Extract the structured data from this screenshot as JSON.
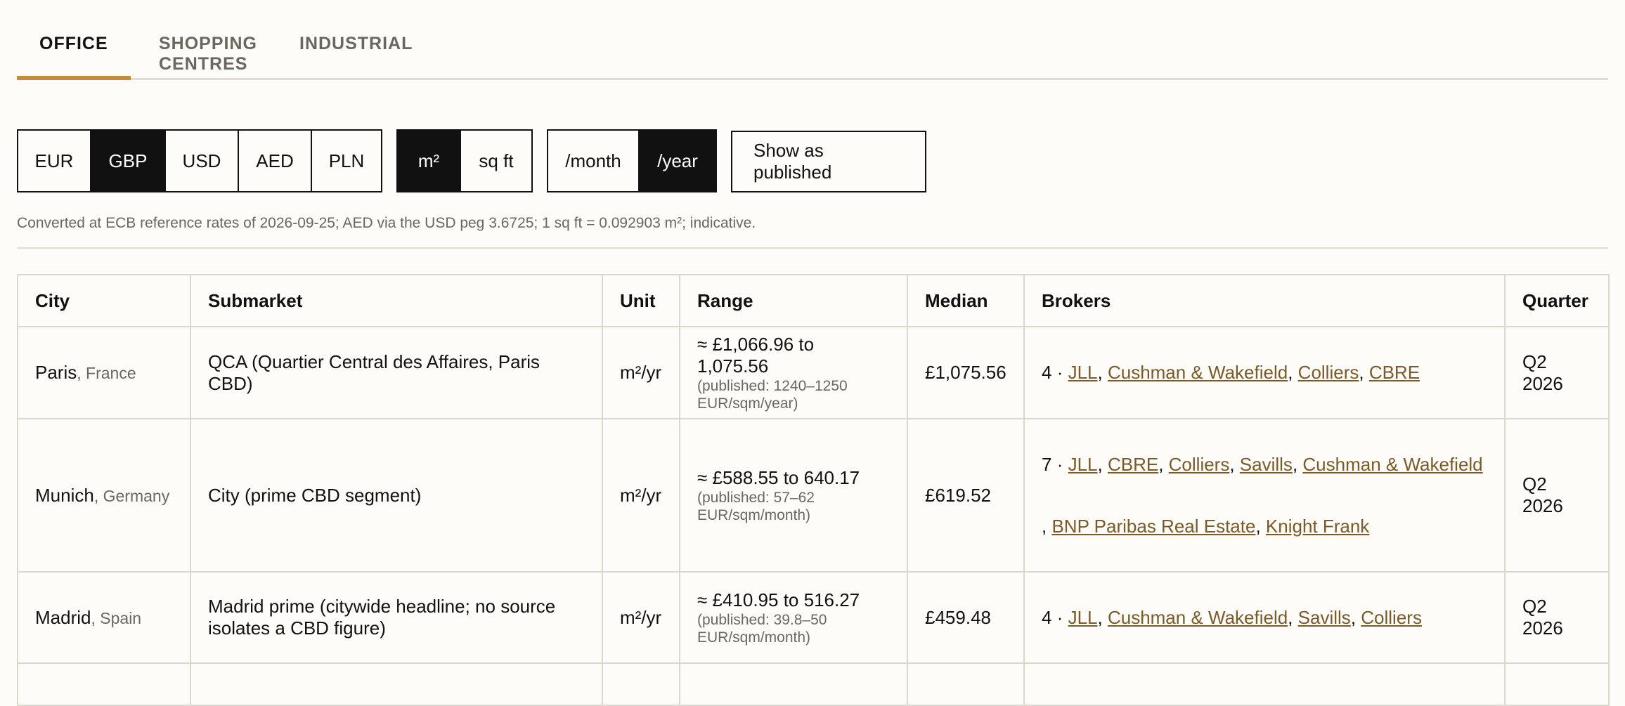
{
  "tabs": [
    {
      "label": "OFFICE",
      "active": true
    },
    {
      "label": "SHOPPING CENTRES",
      "active": false
    },
    {
      "label": "INDUSTRIAL",
      "active": false
    }
  ],
  "currency": {
    "options": [
      "EUR",
      "GBP",
      "USD",
      "AED",
      "PLN"
    ],
    "selected": "GBP"
  },
  "area_unit": {
    "options": [
      "m²",
      "sq ft"
    ],
    "selected": "m²"
  },
  "period": {
    "options": [
      "/month",
      "/year"
    ],
    "selected": "/year"
  },
  "show_published_label": "Show as published",
  "note": "Converted at ECB reference rates of 2026-09-25; AED via the USD peg 3.6725; 1 sq ft = 0.092903 m²; indicative.",
  "table": {
    "headers": [
      "City",
      "Submarket",
      "Unit",
      "Range",
      "Median",
      "Brokers",
      "Quarter"
    ],
    "rows": [
      {
        "city": "Paris",
        "country": "France",
        "submarket": "QCA (Quartier Central des Affaires, Paris CBD)",
        "unit": "m²/yr",
        "range": "≈ £1,066.96 to 1,075.56",
        "published": "(published: 1240–1250 EUR/sqm/year)",
        "median": "£1,075.56",
        "broker_count": "4",
        "brokers": [
          "JLL",
          "Cushman & Wakefield",
          "Colliers",
          "CBRE"
        ],
        "quarter": "Q2 2026"
      },
      {
        "city": "Munich",
        "country": "Germany",
        "submarket": "City (prime CBD segment)",
        "unit": "m²/yr",
        "range": "≈ £588.55 to 640.17",
        "published": "(published: 57–62 EUR/sqm/month)",
        "median": "£619.52",
        "broker_count": "7",
        "brokers": [
          "JLL",
          "CBRE",
          "Colliers",
          "Savills",
          "Cushman & Wakefield",
          "BNP Paribas Real Estate",
          "Knight Frank"
        ],
        "quarter": "Q2 2026"
      },
      {
        "city": "Madrid",
        "country": "Spain",
        "submarket": "Madrid prime (citywide headline; no source isolates a CBD figure)",
        "unit": "m²/yr",
        "range": "≈ £410.95 to 516.27",
        "published": "(published: 39.8–50 EUR/sqm/month)",
        "median": "£459.48",
        "broker_count": "4",
        "brokers": [
          "JLL",
          "Cushman & Wakefield",
          "Savills",
          "Colliers"
        ],
        "quarter": "Q2 2026"
      }
    ]
  },
  "colors": {
    "accent": "#c38c3c",
    "link": "#7a5a28",
    "muted": "#6b6760",
    "selected_bg": "#111111",
    "page_bg": "#fdfcf8"
  }
}
